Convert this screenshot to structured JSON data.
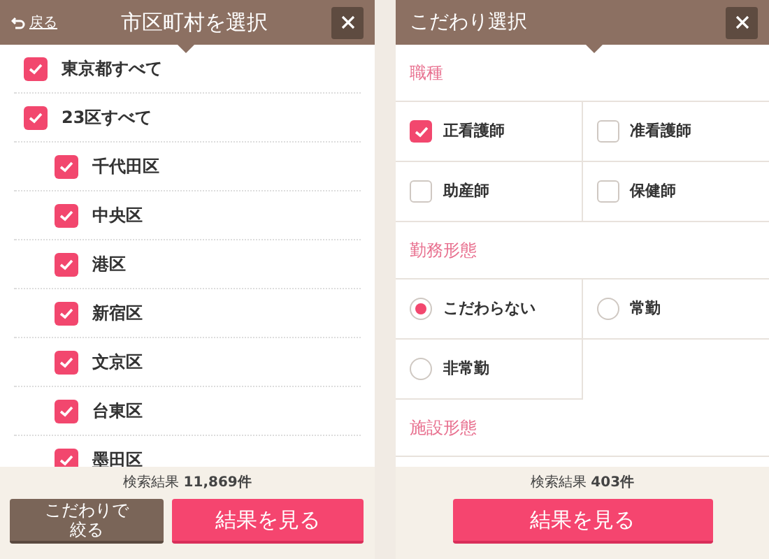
{
  "left": {
    "back": "戻る",
    "title": "市区町村を選択",
    "items": [
      {
        "label": "東京都すべて",
        "checked": true
      },
      {
        "label": "23区すべて",
        "checked": true,
        "children": [
          {
            "label": "千代田区",
            "checked": true
          },
          {
            "label": "中央区",
            "checked": true
          },
          {
            "label": "港区",
            "checked": true
          },
          {
            "label": "新宿区",
            "checked": true
          },
          {
            "label": "文京区",
            "checked": true
          },
          {
            "label": "台東区",
            "checked": true
          },
          {
            "label": "墨田区",
            "checked": true
          }
        ]
      }
    ],
    "result": "検索結果 **11,869件**",
    "buttons": [
      {
        "label": "こだわりで絞る",
        "kind": "secondary"
      },
      {
        "label": "結果を見る",
        "kind": "primary"
      }
    ]
  },
  "right": {
    "title": "こだわり選択",
    "sections": [
      {
        "title": "職種",
        "options": [
          {
            "label": "正看護師",
            "kind": "checkbox",
            "checked": true
          },
          {
            "label": "准看護師",
            "kind": "checkbox",
            "checked": false
          },
          {
            "label": "助産師",
            "kind": "checkbox",
            "checked": false
          },
          {
            "label": "保健師",
            "kind": "checkbox",
            "checked": false
          }
        ]
      },
      {
        "title": "勤務形態",
        "options": [
          {
            "label": "こだわらない",
            "kind": "radio",
            "checked": true
          },
          {
            "label": "常勤",
            "kind": "radio",
            "checked": false
          },
          {
            "label": "非常勤",
            "kind": "radio",
            "checked": false
          }
        ]
      },
      {
        "title": "施設形態"
      }
    ],
    "result": "検索結果 **403件**",
    "buttons": [
      {
        "label": "結果を見る",
        "kind": "primary"
      }
    ]
  }
}
